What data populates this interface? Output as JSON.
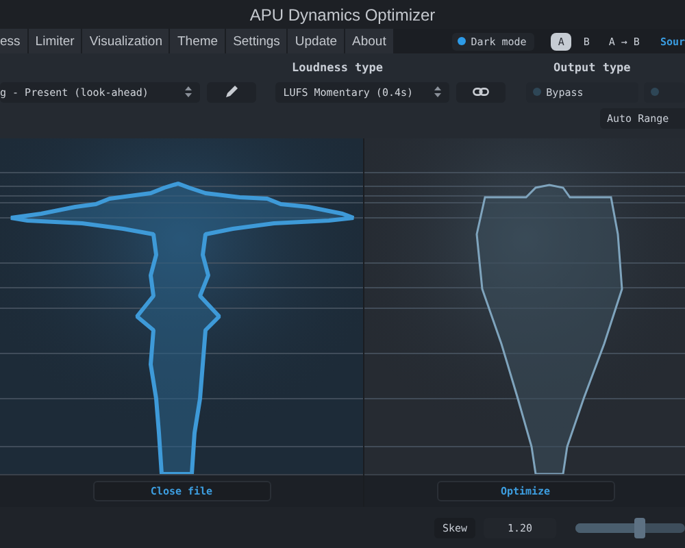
{
  "window": {
    "title": "APU Dynamics Optimizer"
  },
  "tabs": [
    {
      "label": "ess",
      "selected": false
    },
    {
      "label": "Limiter",
      "selected": false
    },
    {
      "label": "Visualization",
      "selected": false
    },
    {
      "label": "Theme",
      "selected": false
    },
    {
      "label": "Settings",
      "selected": false
    },
    {
      "label": "Update",
      "selected": false
    },
    {
      "label": "About",
      "selected": false
    }
  ],
  "dark_mode": {
    "label": "Dark mode",
    "on": true
  },
  "compare": [
    {
      "label": "A",
      "selected": true
    },
    {
      "label": "B",
      "selected": false
    },
    {
      "label": "A → B",
      "selected": false
    }
  ],
  "source_link": "Sour",
  "mode_select": {
    "value": "g - Present (look-ahead)"
  },
  "loudness_type": {
    "label": "Loudness type",
    "value": "LUFS Momentary (0.4s)"
  },
  "output_type": {
    "label": "Output type",
    "options": [
      {
        "label": "Bypass",
        "selected": false
      }
    ]
  },
  "auto_range_button": "Auto Range",
  "panels": [
    {
      "kind": "source",
      "button": "Close file"
    },
    {
      "kind": "result",
      "button": "Optimize"
    }
  ],
  "skew": {
    "label": "Skew",
    "value": "1.20",
    "level": 0.6
  }
}
